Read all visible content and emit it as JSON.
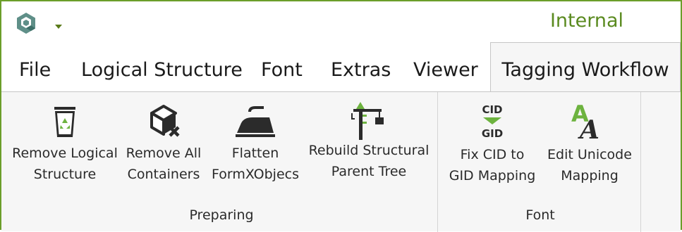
{
  "window": {
    "title": "Internal",
    "accent_color": "#5a8a1f",
    "app_icon": "app-logo-icon"
  },
  "tabs": [
    {
      "label": "File"
    },
    {
      "label": "Logical Structure"
    },
    {
      "label": "Font"
    },
    {
      "label": "Extras"
    },
    {
      "label": "Viewer"
    },
    {
      "label": "Tagging Workflow",
      "active": true
    }
  ],
  "ribbon": {
    "groups": [
      {
        "label": "Preparing",
        "buttons": [
          {
            "line1": "Remove Logical",
            "line2": "Structure",
            "icon": "recycle-bin-icon"
          },
          {
            "line1": "Remove All",
            "line2": "Containers",
            "icon": "box-remove-icon"
          },
          {
            "line1": "Flatten",
            "line2": "FormXObjecs",
            "icon": "iron-icon"
          },
          {
            "line1": "Rebuild Structural",
            "line2": "Parent Tree",
            "icon": "crane-icon"
          }
        ]
      },
      {
        "label": "Font",
        "buttons": [
          {
            "line1": "Fix CID to",
            "line2": "GID Mapping",
            "icon": "cid-gid-icon"
          },
          {
            "line1": "Edit Unicode",
            "line2": "Mapping",
            "icon": "unicode-font-icon"
          }
        ]
      }
    ]
  },
  "icon_text": {
    "cid": "CID",
    "gid": "GID",
    "a_small": "A",
    "a_large": "A"
  }
}
